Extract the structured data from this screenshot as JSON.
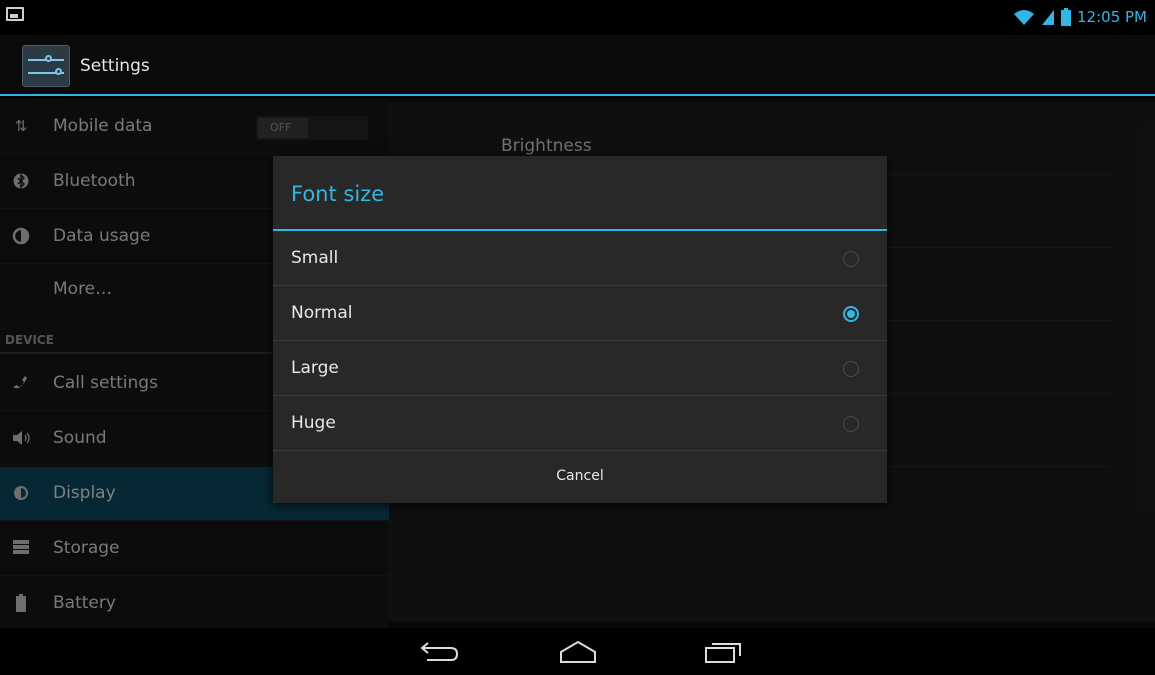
{
  "status_bar": {
    "time": "12:05 PM",
    "icons": [
      "picture-icon",
      "wifi-icon",
      "signal-icon",
      "battery-icon"
    ]
  },
  "action_bar": {
    "title": "Settings",
    "icon": "settings-sliders-icon"
  },
  "sidebar": {
    "items": [
      {
        "label": "Mobile data",
        "icon": "arrows-icon",
        "toggle": "OFF"
      },
      {
        "label": "Bluetooth",
        "icon": "bluetooth-icon"
      },
      {
        "label": "Data usage",
        "icon": "pie-icon"
      },
      {
        "label": "More…",
        "icon": ""
      },
      {
        "label": "Call settings",
        "icon": "phone-icon"
      },
      {
        "label": "Sound",
        "icon": "speaker-icon"
      },
      {
        "label": "Display",
        "icon": "brightness-icon",
        "active": true
      },
      {
        "label": "Storage",
        "icon": "storage-icon"
      },
      {
        "label": "Battery",
        "icon": "battery-icon"
      }
    ],
    "section_device": "DEVICE"
  },
  "right_pane": {
    "first_item": "Brightness"
  },
  "dialog": {
    "title": "Font size",
    "options": [
      {
        "label": "Small",
        "selected": false
      },
      {
        "label": "Normal",
        "selected": true
      },
      {
        "label": "Large",
        "selected": false
      },
      {
        "label": "Huge",
        "selected": false
      }
    ],
    "cancel_label": "Cancel"
  },
  "nav_bar": {
    "buttons": [
      "back-icon",
      "home-icon",
      "recents-icon"
    ]
  },
  "colors": {
    "accent": "#33b5e5",
    "active_item": "#0b4a5f"
  }
}
